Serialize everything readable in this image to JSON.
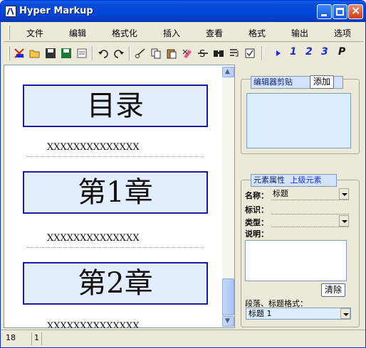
{
  "window": {
    "title": "Hyper Markup"
  },
  "menu": [
    "文件",
    "编辑",
    "格式化",
    "插入",
    "查看",
    "格式",
    "输出",
    "选项"
  ],
  "toolbar": {
    "icons": [
      "new-doc-icon",
      "open-folder-icon",
      "save-icon",
      "save-all-icon",
      "print-preview-icon",
      "undo-icon",
      "redo-icon",
      "cut-icon",
      "copy-icon",
      "paste-icon",
      "delete-icon",
      "strikethrough-icon",
      "find-icon",
      "wrap-icon",
      "check-icon",
      "play-icon"
    ],
    "heading_buttons": [
      "1",
      "2",
      "3",
      "P"
    ]
  },
  "editor": {
    "blocks": [
      {
        "heading": "目录",
        "paragraph": "XXXXXXXXXXXXXX"
      },
      {
        "heading": "第1章",
        "paragraph": "XXXXXXXXXXXXXX"
      },
      {
        "heading": "第2章",
        "paragraph": "XXXXXXXXXXXXXX"
      }
    ]
  },
  "clipboard_panel": {
    "title": "编辑器剪贴",
    "add_label": "添加"
  },
  "props_panel": {
    "title": "元素属性",
    "parent_link": "上级元素",
    "name_label": "名称：",
    "name_value": "标题",
    "id_label": "标识：",
    "id_value": "",
    "type_label": "类型：",
    "type_value": "",
    "desc_label": "说明：",
    "clear_label": "清除",
    "format_label": "段落、标题格式：",
    "format_value": "标题 1"
  },
  "status": {
    "col1": "18",
    "col2": "1"
  },
  "colors": {
    "heading_border": "#1b1ba6",
    "heading_fill": "#e3edfb",
    "title_bar": "#0048d8"
  }
}
